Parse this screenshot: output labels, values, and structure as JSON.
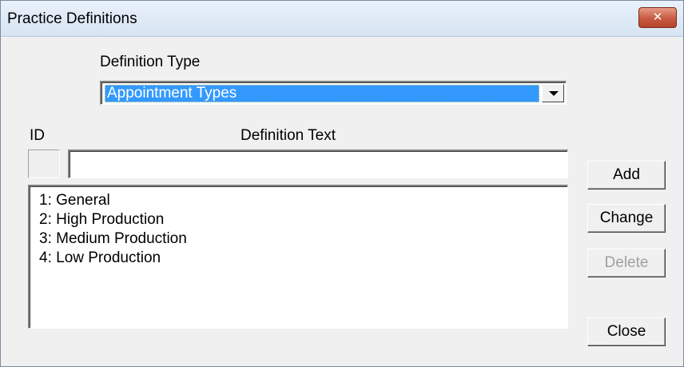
{
  "window": {
    "title": "Practice Definitions",
    "close_glyph": "✕"
  },
  "definition_type": {
    "label": "Definition Type",
    "selected": "Appointment Types"
  },
  "columns": {
    "id_label": "ID",
    "text_label": "Definition Text"
  },
  "editor": {
    "id_value": "",
    "text_value": ""
  },
  "definitions": [
    "1: General",
    "2: High Production",
    "3: Medium Production",
    "4: Low Production"
  ],
  "buttons": {
    "add": "Add",
    "change": "Change",
    "delete": "Delete",
    "close": "Close"
  },
  "icons": {
    "window_close": "close-icon",
    "dropdown": "chevron-down-icon"
  },
  "colors": {
    "selection": "#3399ff",
    "close_button": "#c75b41"
  }
}
